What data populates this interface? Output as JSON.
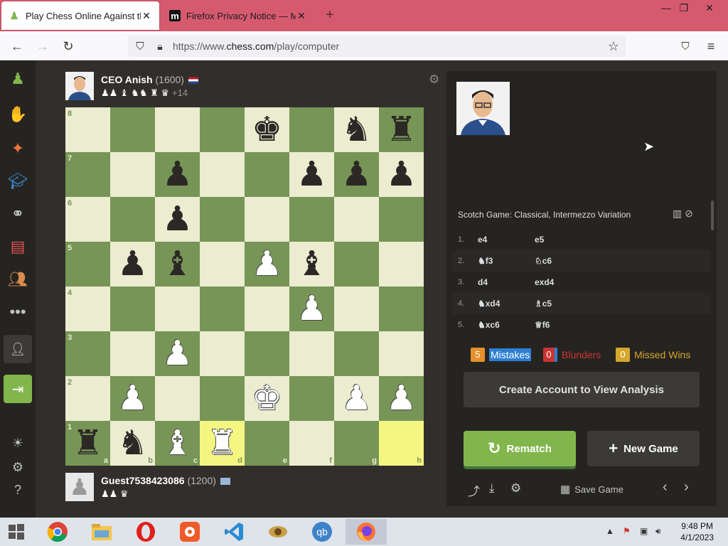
{
  "browser": {
    "tabs": [
      {
        "title": "Play Chess Online Against the C",
        "active": true
      },
      {
        "title": "Firefox Privacy Notice — Mozilla",
        "active": false
      }
    ],
    "url_prefix": "https://www.",
    "url_domain": "chess.com",
    "url_path": "/play/computer"
  },
  "opponent": {
    "name": "CEO Anish",
    "rating": "(1600)",
    "captured": "♟♟ ♝ ♞♞ ♜ ♛",
    "advantage": "+14"
  },
  "player": {
    "name": "Guest7538423086",
    "rating": "(1200)",
    "captured": "♟♟ ♛"
  },
  "board": {
    "ranks": [
      "8",
      "7",
      "6",
      "5",
      "4",
      "3",
      "2",
      "1"
    ],
    "files": [
      "a",
      "b",
      "c",
      "d",
      "e",
      "f",
      "g",
      "h"
    ],
    "position": [
      [
        "",
        "",
        "",
        "",
        "bk",
        "",
        "bn",
        "br"
      ],
      [
        "",
        "",
        "bp",
        "",
        "",
        "bp",
        "bp",
        "bp"
      ],
      [
        "",
        "",
        "bp",
        "",
        "",
        "",
        "",
        ""
      ],
      [
        "",
        "bp",
        "bb",
        "",
        "wp",
        "bb",
        "",
        ""
      ],
      [
        "",
        "",
        "",
        "",
        "",
        "wp",
        "",
        ""
      ],
      [
        "",
        "",
        "wp",
        "",
        "",
        "",
        "",
        ""
      ],
      [
        "",
        "wp",
        "",
        "",
        "wk",
        "",
        "wp",
        "wp"
      ],
      [
        "br",
        "bn",
        "wb",
        "wr",
        "",
        "",
        "",
        ""
      ]
    ],
    "highlighted": [
      "d1",
      "h1"
    ]
  },
  "analysis": {
    "opening": "Scotch Game: Classical, Intermezzo Variation",
    "moves": [
      {
        "num": "1.",
        "white": "e4",
        "black": "e5"
      },
      {
        "num": "2.",
        "white": "♞f3",
        "black": "♘c6"
      },
      {
        "num": "3.",
        "white": "d4",
        "black": "exd4"
      },
      {
        "num": "4.",
        "white": "♞xd4",
        "black": "♗c5"
      },
      {
        "num": "5.",
        "white": "♞xc6",
        "black": "♕f6"
      }
    ],
    "mistakes_count": "5",
    "mistakes_label": "Mistakes",
    "blunders_count": "0",
    "blunders_label": "Blunders",
    "missed_count": "0",
    "missed_label": "Missed Wins",
    "create_account": "Create Account to View Analysis",
    "rematch": "Rematch",
    "new_game": "New Game",
    "save_game": "Save Game"
  },
  "taskbar": {
    "time": "9:48 PM",
    "date": "4/1/2023"
  },
  "colors": {
    "tab_bar": "#d65a6e",
    "board_light": "#ebecd0",
    "board_dark": "#779556",
    "highlight": "#f5f682",
    "accent_green": "#81b64c"
  }
}
